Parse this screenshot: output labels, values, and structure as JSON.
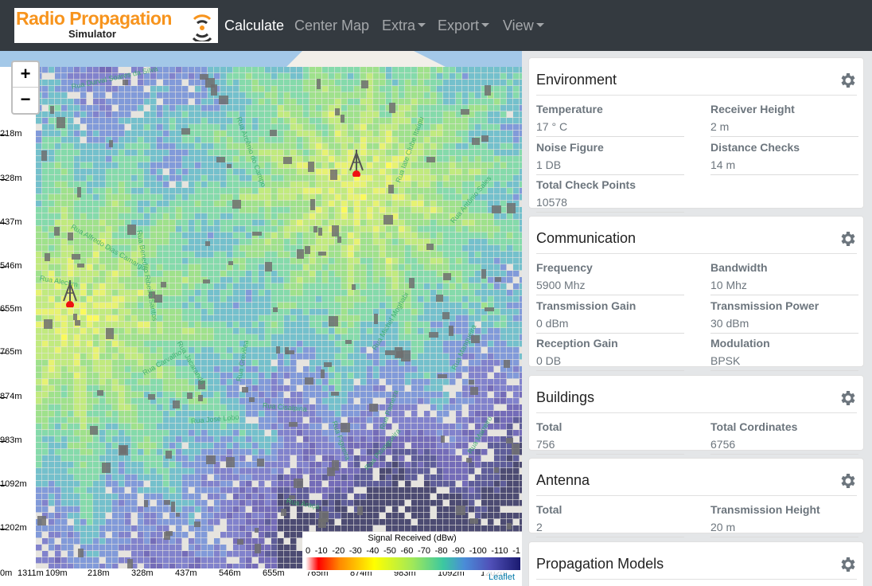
{
  "brand": {
    "title": "Radio Propagation",
    "subtitle": "Simulator"
  },
  "nav": {
    "calculate": "Calculate",
    "center_map": "Center Map",
    "extra": "Extra",
    "export": "Export",
    "view": "View"
  },
  "map": {
    "zoom_in": "+",
    "zoom_out": "−",
    "vscale": [
      "218m",
      "328m",
      "437m",
      "546m",
      "655m",
      "765m",
      "874m",
      "983m",
      "1092m",
      "1202m"
    ],
    "hscale": [
      "0m",
      "1311m",
      "109m",
      "218m",
      "328m",
      "437m",
      "546m",
      "655m",
      "765m",
      "874m",
      "983m",
      "1092m",
      "1202m"
    ],
    "legend_title": "Signal Received (dBw)",
    "legend_ticks": [
      "0",
      "-10",
      "-20",
      "-30",
      "-40",
      "-50",
      "-60",
      "-70",
      "-80",
      "-90",
      "-100",
      "-110",
      "-1"
    ],
    "attribution": "Leaflet",
    "street_labels": [
      "Rua Durval Soares da Silva",
      "Rua Arcênio do Campo",
      "Rua Iate Clube Itaúpu",
      "Rua Antônio Sales",
      "Rua Alfredo Dias Camargo",
      "Rua Alecrim",
      "Rua Benedito Ribeiro Santos",
      "Rua Carvalho",
      "Rua Jacarandá",
      "Rua Grevilea",
      "Rua Cisalpina",
      "Rua José Lobo",
      "Rua Michel Moghabi",
      "Rua Figueira",
      "Rua Mangueira",
      "Rua Pitangueira",
      "Rua Paineira",
      "Rua Araçá",
      "Rua Marreiro"
    ]
  },
  "panels": {
    "environment": {
      "title": "Environment",
      "fields": [
        {
          "label": "Temperature",
          "value": "17 ° C"
        },
        {
          "label": "Receiver Height",
          "value": "2 m"
        },
        {
          "label": "Noise Figure",
          "value": "1 DB"
        },
        {
          "label": "Distance Checks",
          "value": "14 m"
        },
        {
          "label": "Total Check Points",
          "value": "10578"
        }
      ]
    },
    "communication": {
      "title": "Communication",
      "fields": [
        {
          "label": "Frequency",
          "value": "5900 Mhz"
        },
        {
          "label": "Bandwidth",
          "value": "10 Mhz"
        },
        {
          "label": "Transmission Gain",
          "value": "0 dBm"
        },
        {
          "label": "Transmission Power",
          "value": "30 dBm"
        },
        {
          "label": "Reception Gain",
          "value": "0 DB"
        },
        {
          "label": "Modulation",
          "value": "BPSK"
        }
      ]
    },
    "buildings": {
      "title": "Buildings",
      "fields": [
        {
          "label": "Total",
          "value": "756"
        },
        {
          "label": "Total Cordinates",
          "value": "6756"
        }
      ]
    },
    "antenna": {
      "title": "Antenna",
      "fields": [
        {
          "label": "Total",
          "value": "2"
        },
        {
          "label": "Transmission Height",
          "value": "20 m"
        }
      ]
    },
    "propagation": {
      "title": "Propagation Models"
    }
  },
  "icons": {
    "settings": "gear-icon",
    "antenna": "antenna-icon",
    "logo": "signal-icon"
  }
}
